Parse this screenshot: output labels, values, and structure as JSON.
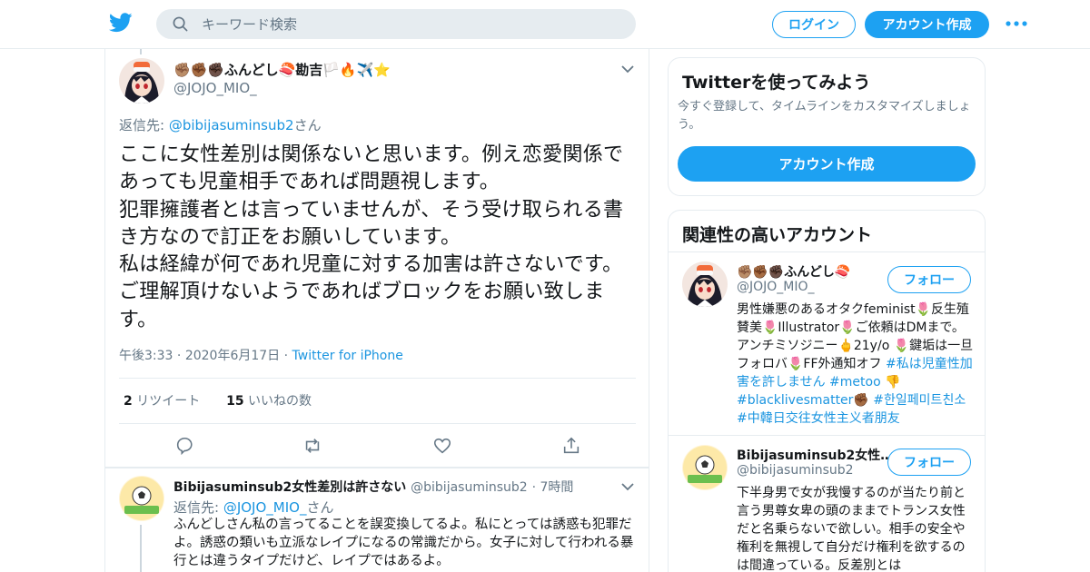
{
  "header": {
    "search_placeholder": "キーワード検索",
    "login_label": "ログイン",
    "signup_label": "アカウント作成",
    "brand_color": "#1da1f2"
  },
  "tweet": {
    "name": "✊🏽✊🏾✊🏿ふんどし🍣勘吉🏳️🔥✈️⭐",
    "handle": "@JOJO_MIO_",
    "reply_prefix": "返信先: ",
    "reply_to": "@bibijasuminsub2",
    "reply_suffix": "さん",
    "text": "ここに女性差別は関係ないと思います。例え恋愛関係であっても児童相手であれば問題視します。\n犯罪擁護者とは言っていませんが、そう受け取られる書き方なので訂正をお願いしています。\n私は経緯が何であれ児童に対する加害は許さないです。ご理解頂けないようであればブロックをお願い致します。",
    "time": "午後3:33",
    "date": "2020年6月17日",
    "source": "Twitter for iPhone",
    "retweet_count": "2",
    "retweet_label": " リツイート",
    "like_count": "15",
    "like_label": " いいねの数"
  },
  "reply": {
    "name": "Bibijasuminsub2女性差別は許さない",
    "handle": "@bibijasuminsub2",
    "age": "7時間",
    "reply_prefix": "返信先: ",
    "reply_to": "@JOJO_MIO_",
    "reply_suffix": "さん",
    "text": "ふんどしさん私の言ってることを誤変換してるよ。私にとっては誘惑も犯罪だよ。誘惑の類いも立派なレイプになるの常識だから。女子に対して行われる暴行とは違うタイプだけど、レイプではあるよ。"
  },
  "sidebar": {
    "signup_card": {
      "title": "Twitterを使ってみよう",
      "desc": "今すぐ登録して、タイムラインをカスタマイズしましょう。",
      "button": "アカウント作成"
    },
    "related": {
      "title": "関連性の高いアカウント",
      "follow_label": "フォロー",
      "accounts": [
        {
          "name": "✊🏽✊🏾✊🏿ふんどし🍣",
          "handle": "@JOJO_MIO_",
          "bio_plain": "男性嫌悪のあるオタクfeminist🌷反生殖賛美🌷Illustrator🌷ご依頼はDMまで。アンチミソジニー🖕21y/o 🌷鍵垢は一旦フォロバ🌷FF外通知オフ ",
          "bio_tags": "#私は児童性加害を許しません #metoo 👎 #blacklivesmatter✊🏾 #한일페미트친소 #中韓日交往女性主义者朋友"
        },
        {
          "name": "Bibijasuminsub2女性…",
          "handle": "@bibijasuminsub2",
          "bio_plain": "下半身男で女が我慢するのが当たり前と言う男尊女卑の頭のままでトランス女性だと名乗らないで欲しい。相手の安全や権利を無視して自分だけ権利を欲するのは間違っている。反差別とは",
          "bio_tags": ""
        }
      ]
    }
  }
}
